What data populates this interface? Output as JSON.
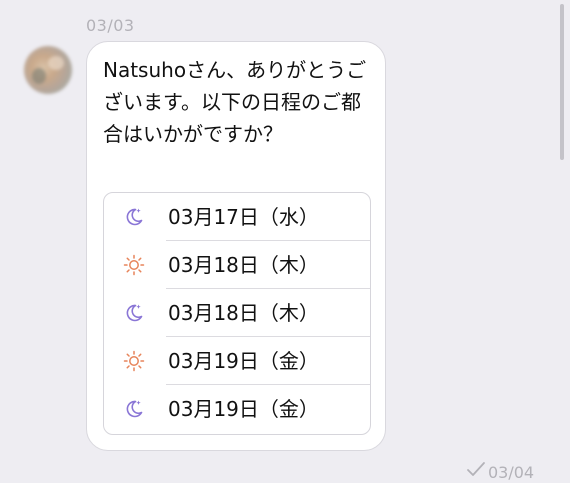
{
  "messages": {
    "incoming": {
      "date": "03/03",
      "text": "Natsuhoさん、ありがとうございます。以下の日程のご都合はいかがですか？",
      "options": [
        {
          "label": "03月17日（水）",
          "icon": "moon-icon"
        },
        {
          "label": "03月18日（木）",
          "icon": "sun-icon"
        },
        {
          "label": "03月18日（木）",
          "icon": "moon-icon"
        },
        {
          "label": "03月19日（金）",
          "icon": "sun-icon"
        },
        {
          "label": "03月19日（金）",
          "icon": "moon-icon"
        }
      ]
    },
    "next_status": {
      "date": "03/04",
      "icon": "checkmark-icon"
    }
  },
  "colors": {
    "background": "#eeedf2",
    "bubble": "#ffffff",
    "moon": "#8a76d6",
    "sun": "#e7845a",
    "muted_text": "#b3b2b8"
  }
}
